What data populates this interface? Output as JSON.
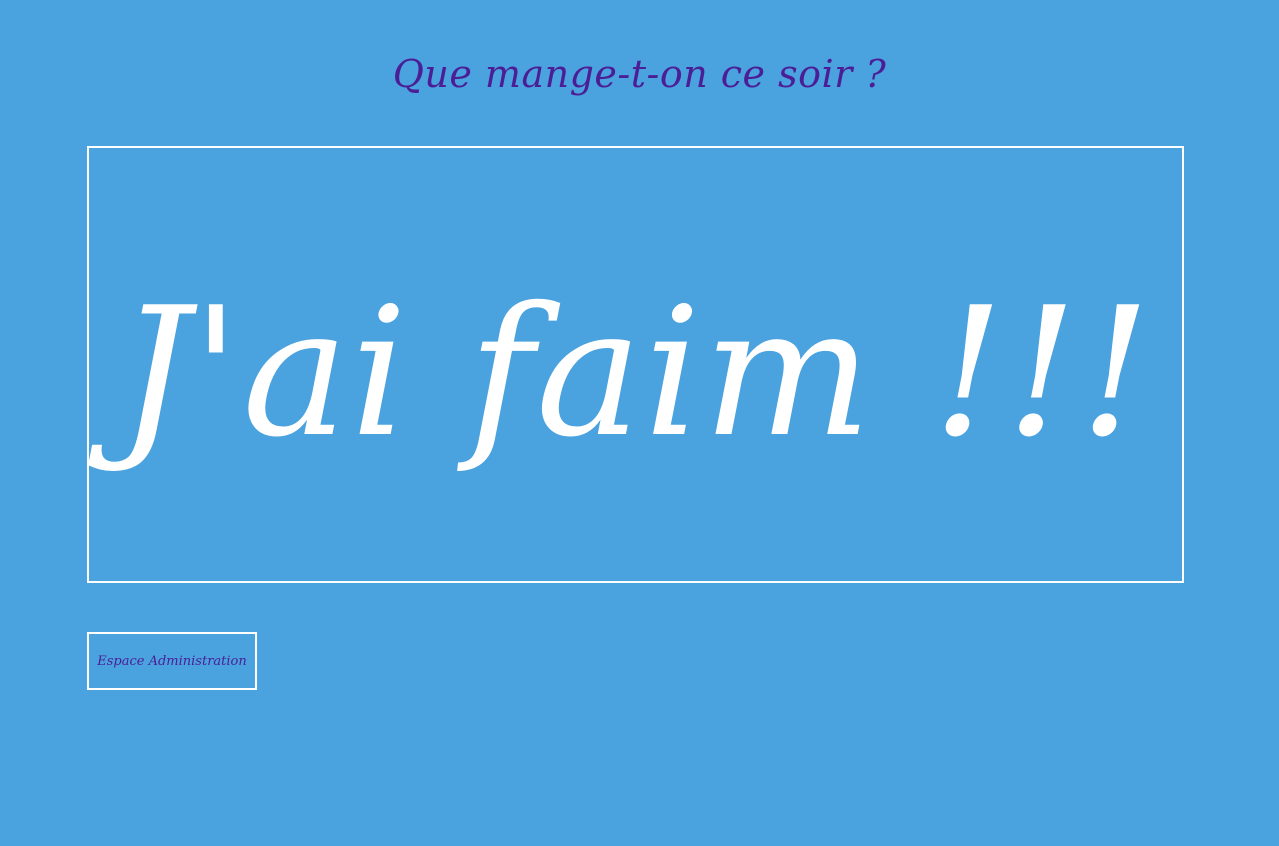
{
  "header": {
    "title": "Que mange-t-on ce soir ?"
  },
  "main": {
    "hungry_label": "J'ai faim !!!"
  },
  "footer": {
    "admin_label": "Espace Administration"
  },
  "colors": {
    "background": "#4aa2df",
    "title": "#4b1e96",
    "main_text": "#ffffff",
    "border": "#ffffff"
  }
}
